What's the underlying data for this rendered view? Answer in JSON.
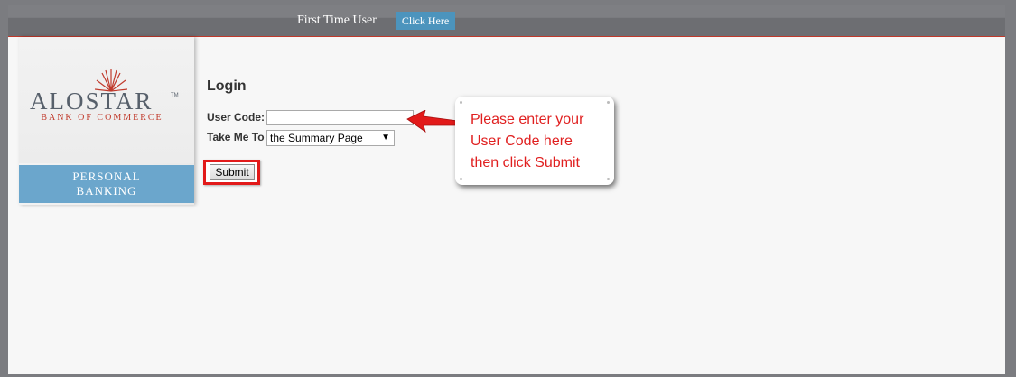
{
  "header": {
    "first_time_label": "First Time User",
    "click_here_label": "Click Here"
  },
  "logo": {
    "name": "ALOSTAR",
    "tm": "TM",
    "subtitle": "BANK OF COMMERCE"
  },
  "sidebar": {
    "personal_banking_line1": "PERSONAL",
    "personal_banking_line2": "BANKING"
  },
  "login": {
    "title": "Login",
    "user_code_label": "User Code:",
    "user_code_value": "",
    "take_me_to_label": "Take Me To",
    "take_me_to_selected": "the Summary Page",
    "submit_label": "Submit"
  },
  "callout": {
    "line1": "Please enter your",
    "line2": "User Code here",
    "line3": "then click Submit"
  },
  "colors": {
    "accent_blue": "#4c94bd",
    "panel_blue": "#6ba6cc",
    "highlight_red": "#e21a1a",
    "callout_text": "#e02020"
  },
  "icons": {
    "logo_star": "sunburst-star-icon",
    "dropdown": "chevron-down-icon",
    "pointer_arrow": "red-arrow-icon"
  }
}
